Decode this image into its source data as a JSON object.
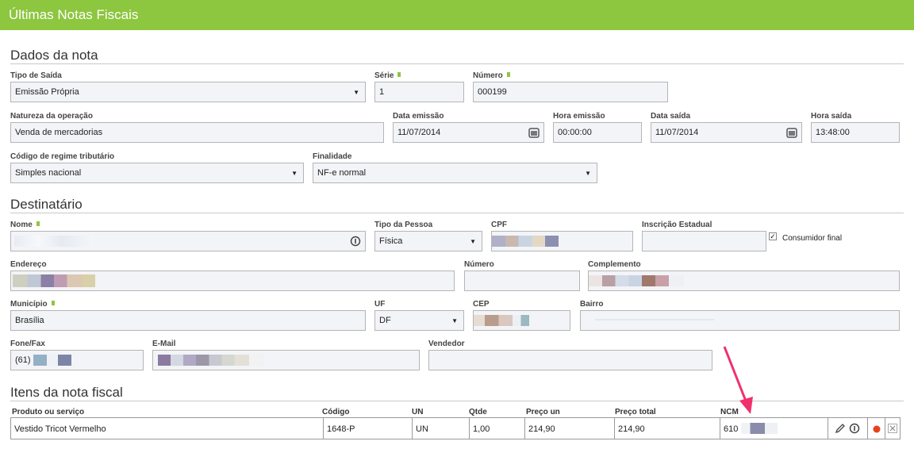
{
  "header": {
    "title": "Últimas Notas Fiscais"
  },
  "sections": {
    "dados": "Dados da nota",
    "destinatario": "Destinatário",
    "itens": "Itens da nota fiscal"
  },
  "dados_nota": {
    "tipo_saida": {
      "label": "Tipo de Saída",
      "value": "Emissão Própria"
    },
    "serie": {
      "label": "Série",
      "value": "1"
    },
    "numero": {
      "label": "Número",
      "value": "000199"
    },
    "natureza": {
      "label": "Natureza da operação",
      "value": "Venda de mercadorias"
    },
    "data_emissao": {
      "label": "Data emissão",
      "value": "11/07/2014"
    },
    "hora_emissao": {
      "label": "Hora emissão",
      "value": "00:00:00"
    },
    "data_saida": {
      "label": "Data saída",
      "value": "11/07/2014"
    },
    "hora_saida": {
      "label": "Hora saída",
      "value": "13:48:00"
    },
    "regime": {
      "label": "Código de regime tributário",
      "value": "Simples nacional"
    },
    "finalidade": {
      "label": "Finalidade",
      "value": "NF-e normal"
    }
  },
  "destinatario": {
    "nome": {
      "label": "Nome",
      "value": ""
    },
    "tipo_pessoa": {
      "label": "Tipo da Pessoa",
      "value": "Física"
    },
    "cpf": {
      "label": "CPF",
      "value": ""
    },
    "ie": {
      "label": "Inscrição Estadual",
      "value": ""
    },
    "consumidor_final": {
      "label": "Consumidor final",
      "checked": true
    },
    "endereco": {
      "label": "Endereço",
      "value": ""
    },
    "numero": {
      "label": "Número",
      "value": ""
    },
    "complemento": {
      "label": "Complemento",
      "value": ""
    },
    "municipio": {
      "label": "Município",
      "value": "Brasília"
    },
    "uf": {
      "label": "UF",
      "value": "DF"
    },
    "cep": {
      "label": "CEP",
      "value": ""
    },
    "bairro": {
      "label": "Bairro",
      "value": ""
    },
    "fone": {
      "label": "Fone/Fax",
      "value": "(61)"
    },
    "email": {
      "label": "E-Mail",
      "value": ""
    },
    "vendedor": {
      "label": "Vendedor",
      "value": ""
    }
  },
  "itens": {
    "columns": [
      "Produto ou serviço",
      "Código",
      "UN",
      "Qtde",
      "Preço un",
      "Preço total",
      "NCM"
    ],
    "rows": [
      {
        "produto": "Vestido Tricot Vermelho",
        "codigo": "1648-P",
        "un": "UN",
        "qtde": "1,00",
        "preco_un": "214,90",
        "preco_total": "214,90",
        "ncm": "610"
      }
    ]
  },
  "icons": {
    "calendar": "calendar-icon",
    "info": "info-icon",
    "edit": "pencil-icon",
    "status": "status-dot-icon",
    "close": "close-icon"
  },
  "colors": {
    "header": "#8dc63f",
    "annotation_arrow": "#f0306d",
    "status_dot": "#e8401c"
  }
}
